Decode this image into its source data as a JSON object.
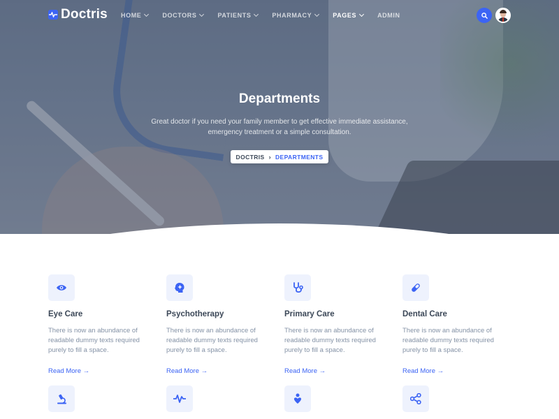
{
  "brand": {
    "name": "Doctris",
    "accent": "#3c64f4"
  },
  "nav": {
    "items": [
      {
        "label": "HOME",
        "dropdown": true
      },
      {
        "label": "DOCTORS",
        "dropdown": true
      },
      {
        "label": "PATIENTS",
        "dropdown": true
      },
      {
        "label": "PHARMACY",
        "dropdown": true
      },
      {
        "label": "PAGES",
        "dropdown": true,
        "active": true
      },
      {
        "label": "ADMIN",
        "dropdown": false
      }
    ],
    "search_icon": "search-icon",
    "avatar_icon": "user-avatar"
  },
  "hero": {
    "title": "Departments",
    "subtitle": "Great doctor if you need your family member to get effective immediate assistance, emergency treatment or a simple consultation.",
    "breadcrumb": {
      "home": "DOCTRIS",
      "separator": "›",
      "current": "DEPARTMENTS"
    }
  },
  "departments": [
    {
      "title": "Eye Care",
      "icon": "eye-icon",
      "text": "There is now an abundance of readable dummy texts required purely to fill a space.",
      "link": "Read More →"
    },
    {
      "title": "Psychotherapy",
      "icon": "brain-icon",
      "text": "There is now an abundance of readable dummy texts required purely to fill a space.",
      "link": "Read More →"
    },
    {
      "title": "Primary Care",
      "icon": "stethoscope-icon",
      "text": "There is now an abundance of readable dummy texts required purely to fill a space.",
      "link": "Read More →"
    },
    {
      "title": "Dental Care",
      "icon": "capsule-icon",
      "text": "There is now an abundance of readable dummy texts required purely to fill a space.",
      "link": "Read More →"
    },
    {
      "icon": "microscope-icon"
    },
    {
      "icon": "pulse-icon"
    },
    {
      "icon": "heart-hand-icon"
    },
    {
      "icon": "share-nodes-icon"
    }
  ]
}
